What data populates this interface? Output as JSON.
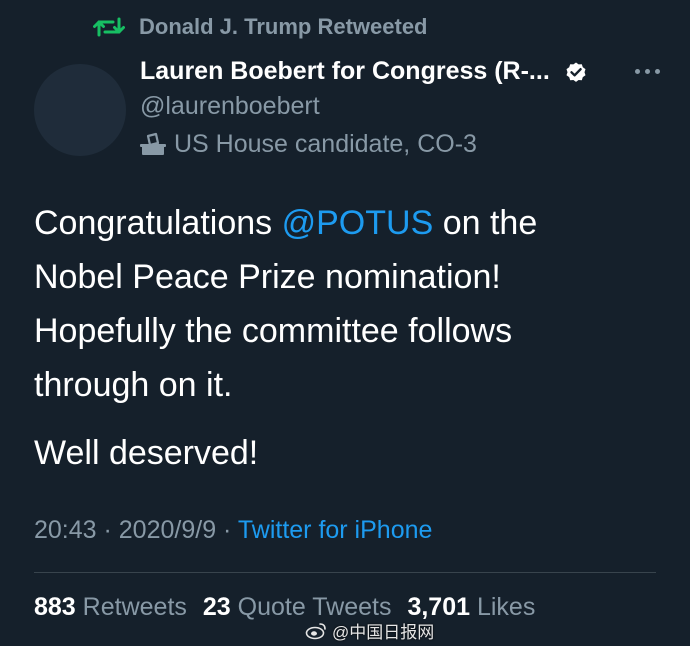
{
  "retweet": {
    "label": "Donald J. Trump Retweeted",
    "icon": "retweet-icon",
    "color": "#17bf63"
  },
  "author": {
    "display_name": "Lauren Boebert for Congress (R-...",
    "handle": "@laurenboebert",
    "candidate_label": "US House candidate, CO-3",
    "verified": true
  },
  "tweet": {
    "text_before": "Congratulations ",
    "mention": "@POTUS",
    "text_after": " on the Nobel Peace Prize nomination! Hopefully the committee follows through on it.",
    "second_paragraph": "Well deserved!"
  },
  "meta": {
    "time": "20:43",
    "separator": " · ",
    "date": "2020/9/9",
    "source": "Twitter for iPhone"
  },
  "stats": {
    "retweets_count": "883",
    "retweets_label": "Retweets",
    "quote_count": "23",
    "quote_label": "Quote Tweets",
    "likes_count": "3,701",
    "likes_label": "Likes"
  },
  "watermark": {
    "text": "@中国日报网"
  },
  "colors": {
    "background": "#15202b",
    "secondary_text": "#8899a6",
    "link": "#1d9bf0",
    "divider": "#38444d"
  }
}
